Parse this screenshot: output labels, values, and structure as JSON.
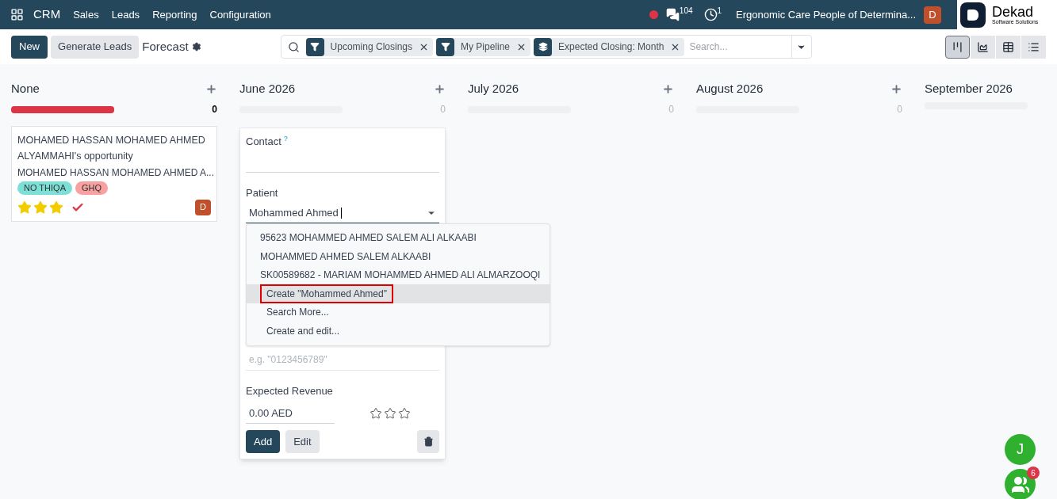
{
  "navbar": {
    "brand": "CRM",
    "menu": [
      "Sales",
      "Leads",
      "Reporting",
      "Configuration"
    ],
    "chat_count": "104",
    "activity_count": "1",
    "company": "Ergonomic Care People of Determina...",
    "avatar": "D",
    "logo": {
      "name": "Dekad",
      "tagline": "Software Solutions"
    }
  },
  "control_panel": {
    "new_button": "New",
    "generate_button": "Generate Leads",
    "title": "Forecast",
    "facets": [
      {
        "kind": "filter",
        "label": "Upcoming Closings"
      },
      {
        "kind": "filter",
        "label": "My Pipeline"
      },
      {
        "kind": "group",
        "label": "Expected Closing: Month"
      }
    ],
    "search_placeholder": "Search...",
    "views": [
      {
        "kind": "kanban",
        "selected": true
      },
      {
        "kind": "graph",
        "selected": false
      },
      {
        "kind": "pivot",
        "selected": false
      },
      {
        "kind": "list",
        "selected": false
      }
    ]
  },
  "columns": [
    {
      "title": "None",
      "count": "0",
      "level": 1,
      "color": "#dc3545"
    },
    {
      "title": "June 2026",
      "count": "0",
      "level": 0
    },
    {
      "title": "July 2026",
      "count": "0",
      "level": 0
    },
    {
      "title": "August 2026",
      "count": "0",
      "level": 0
    },
    {
      "title": "September 2026",
      "level": 0
    }
  ],
  "card": {
    "title": "MOHAMED HASSAN MOHAMED AHMED ALYAMMAHI's opportunity",
    "subtitle": "MOHAMED HASSAN MOHAMED AHMED A...",
    "tags": [
      {
        "label": "NO THIQA",
        "color": "#7de0d6"
      },
      {
        "label": "GHQ",
        "color": "#f7a1a1"
      }
    ],
    "stars": 3,
    "done": true,
    "avatar": "D"
  },
  "quick_create": {
    "contact_label": "Contact",
    "contact_help": "?",
    "patient_label": "Patient",
    "patient_value": "Mohammed Ahmed",
    "options": [
      {
        "kind": "record",
        "label": "95623 MOHAMMED AHMED SALEM ALI ALKAABI",
        "selected": false
      },
      {
        "kind": "record",
        "label": "MOHAMMED AHMED SALEM ALKAABI",
        "selected": false
      },
      {
        "kind": "record",
        "label": "SK00589682 - MARIAM MOHAMMED AHMED ALI ALMARZOOQI",
        "selected": false
      },
      {
        "kind": "action",
        "label": "Create \"Mohammed Ahmed\"",
        "selected": true
      },
      {
        "kind": "action",
        "label": "Search More...",
        "selected": false
      },
      {
        "kind": "action",
        "label": "Create and edit...",
        "selected": false
      }
    ],
    "phone_placeholder": "e.g. \"0123456789\"",
    "revenue_label": "Expected Revenue",
    "revenue_value": "0.00 AED",
    "stars": 0,
    "add_button": "Add",
    "edit_button": "Edit"
  },
  "floating": {
    "user_initial": "J",
    "group_badge": "6"
  }
}
